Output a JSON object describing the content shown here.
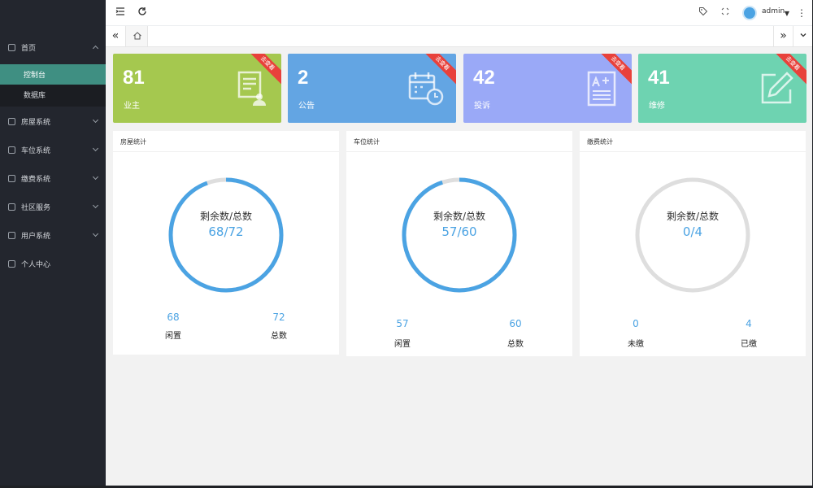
{
  "sidebar": {
    "items": [
      {
        "label": "首页",
        "expanded": true
      },
      {
        "label": "房屋系统"
      },
      {
        "label": "车位系统"
      },
      {
        "label": "缴费系统"
      },
      {
        "label": "社区服务"
      },
      {
        "label": "用户系统"
      },
      {
        "label": "个人中心"
      }
    ],
    "subitems": [
      {
        "label": "控制台",
        "active": true
      },
      {
        "label": "数据库"
      }
    ]
  },
  "header": {
    "user": "admin",
    "icons": [
      "menu-fold-icon",
      "refresh-icon",
      "tag-icon",
      "fullscreen-icon",
      "more-icon"
    ]
  },
  "stats": [
    {
      "value": "81",
      "label": "业主",
      "ribbon": "去查看",
      "color": "#a5c84f",
      "icon": "document-person-icon"
    },
    {
      "value": "2",
      "label": "公告",
      "ribbon": "去查看",
      "color": "#63a5e3",
      "icon": "calendar-clock-icon"
    },
    {
      "value": "42",
      "label": "投诉",
      "ribbon": "去查看",
      "color": "#9aa9f7",
      "icon": "document-edit-icon"
    },
    {
      "value": "41",
      "label": "维修",
      "ribbon": "去查看",
      "color": "#6ed3b1",
      "icon": "pencil-square-icon"
    }
  ],
  "panels": [
    {
      "title": "房屋统计",
      "center_label": "剩余数/总数",
      "center_value": "68/72",
      "remaining": 68,
      "total": 72,
      "left_num": "68",
      "left_label": "闲置",
      "right_num": "72",
      "right_label": "总数"
    },
    {
      "title": "车位统计",
      "center_label": "剩余数/总数",
      "center_value": "57/60",
      "remaining": 57,
      "total": 60,
      "left_num": "57",
      "left_label": "闲置",
      "right_num": "60",
      "right_label": "总数"
    },
    {
      "title": "缴费统计",
      "center_label": "剩余数/总数",
      "center_value": "0/4",
      "remaining": 0,
      "total": 4,
      "left_num": "0",
      "left_label": "未缴",
      "right_num": "4",
      "right_label": "已缴"
    }
  ],
  "colors": {
    "ring_fill": "#4ba3e3",
    "ring_track": "#dedede",
    "sidebar_active": "#3f8f82"
  }
}
